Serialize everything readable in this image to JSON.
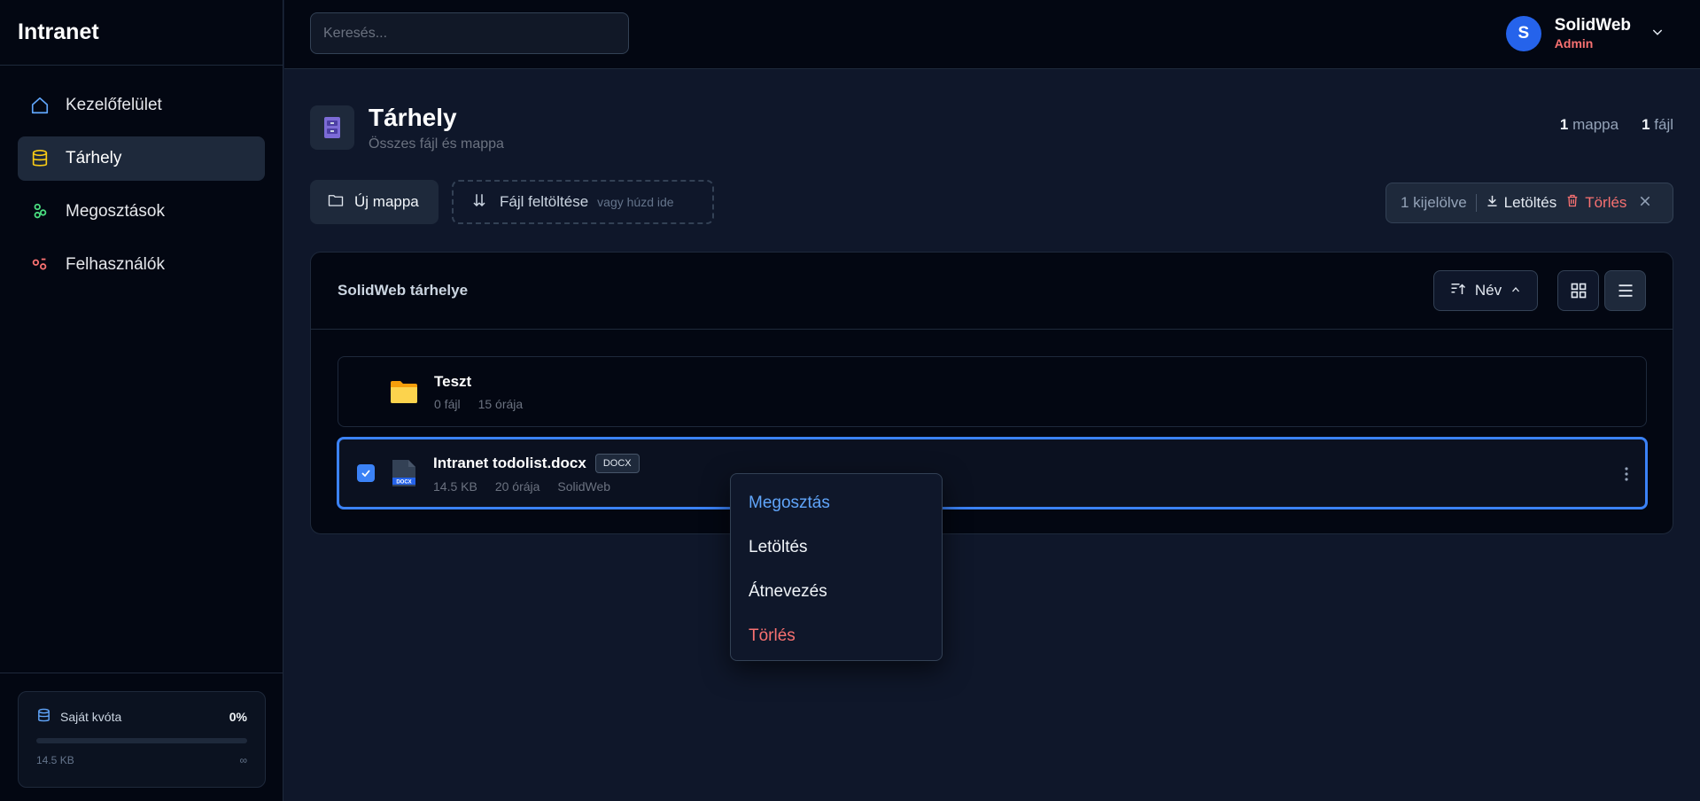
{
  "app": {
    "brand": "Intranet"
  },
  "sidebar": {
    "items": [
      {
        "label": "Kezelőfelület",
        "icon": "home-icon",
        "active": false
      },
      {
        "label": "Tárhely",
        "icon": "database-icon",
        "active": true
      },
      {
        "label": "Megosztások",
        "icon": "share-icon",
        "active": false
      },
      {
        "label": "Felhasználók",
        "icon": "users-icon",
        "active": false
      }
    ],
    "quota": {
      "label": "Saját kvóta",
      "percent_text": "0%",
      "percent": 0,
      "used": "14.5 KB",
      "limit": "∞"
    }
  },
  "topbar": {
    "search_placeholder": "Keresés...",
    "user": {
      "initial": "S",
      "name": "SolidWeb",
      "role": "Admin"
    }
  },
  "page": {
    "title": "Tárhely",
    "subtitle": "Összes fájl és mappa",
    "counts": {
      "folders_num": "1",
      "folders_label": "mappa",
      "files_num": "1",
      "files_label": "fájl"
    }
  },
  "actions": {
    "new_folder": "Új mappa",
    "upload": "Fájl feltöltése",
    "upload_hint": "vagy húzd ide",
    "selection": {
      "count_text": "1 kijelölve",
      "download": "Letöltés",
      "delete": "Törlés"
    }
  },
  "panel": {
    "title": "SolidWeb tárhelye",
    "sort_label": "Név",
    "entries": [
      {
        "type": "folder",
        "name": "Teszt",
        "meta": [
          "0 fájl",
          "15 órája"
        ]
      },
      {
        "type": "file",
        "name": "Intranet todolist.docx",
        "badge": "DOCX",
        "icon_label": "DOCX",
        "meta": [
          "14.5 KB",
          "20 órája",
          "SolidWeb"
        ],
        "selected": true
      }
    ]
  },
  "context_menu": {
    "items": [
      "Megosztás",
      "Letöltés",
      "Átnevezés",
      "Törlés"
    ]
  },
  "colors": {
    "accent": "#3b82f6",
    "danger": "#f87171",
    "background": "#0f172a",
    "sidebar": "#030712"
  }
}
